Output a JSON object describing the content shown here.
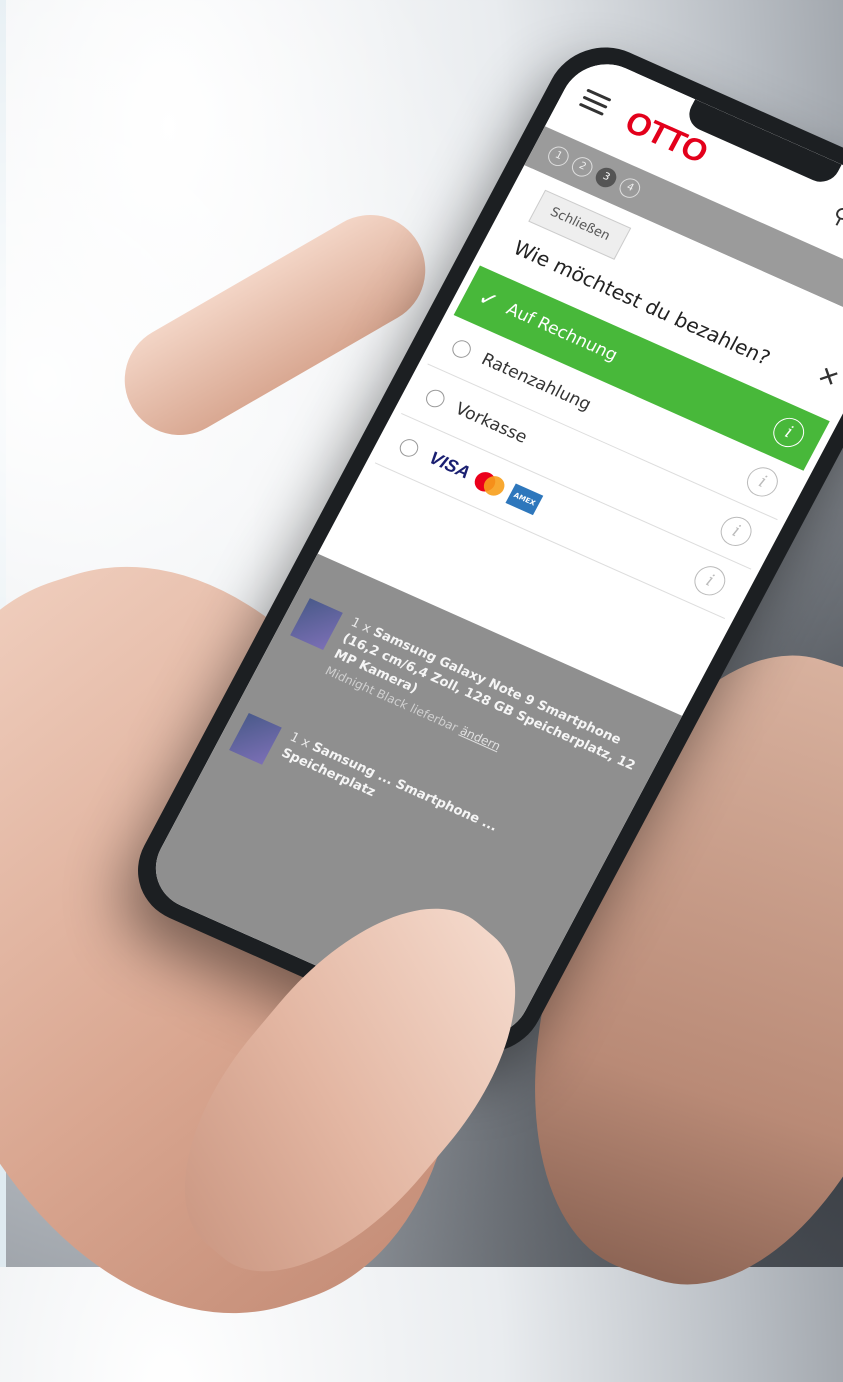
{
  "brand": {
    "logo": "OTTO",
    "color": "#e3001b"
  },
  "steps": [
    "1",
    "2",
    "3",
    "4"
  ],
  "modal": {
    "close_label": "Schließen",
    "title": "Wie möchtest du bezahlen?",
    "options": [
      {
        "label": "Auf Rechnung",
        "selected": true
      },
      {
        "label": "Ratenzahlung",
        "selected": false
      },
      {
        "label": "Vorkasse",
        "selected": false
      },
      {
        "label": "",
        "cards": [
          "VISA",
          "Mastercard",
          "AMEX"
        ],
        "selected": false
      }
    ],
    "info_glyph": "i",
    "accent": "#48b83a"
  },
  "products": [
    {
      "qty": "1 x",
      "name": "Samsung Galaxy Note 9 Smartphone (16,2 cm/6,4 Zoll, 128 GB Speicherplatz, 12 MP Kamera)",
      "color": "Midnight Black",
      "stock": "lieferbar",
      "link": "ändern"
    },
    {
      "qty": "1 x",
      "name": "Samsung ... Smartphone ... Speicherplatz",
      "color": "",
      "stock": "",
      "link": ""
    }
  ]
}
